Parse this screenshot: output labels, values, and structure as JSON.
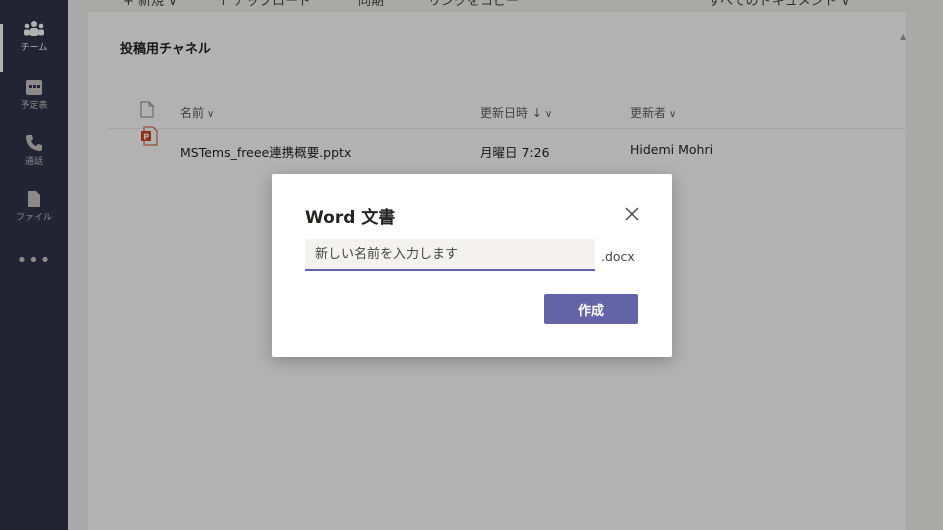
{
  "rail": {
    "items": [
      {
        "label": "チーム",
        "icon": "teams-icon"
      },
      {
        "label": "予定表",
        "icon": "calendar-icon"
      },
      {
        "label": "通話",
        "icon": "phone-icon"
      },
      {
        "label": "ファイル",
        "icon": "file-icon"
      }
    ],
    "more": "•••"
  },
  "toolbar": {
    "new_label": "+ 新規 ∨",
    "upload_label": "↑ アップロード",
    "sync_label": "同期",
    "copy_link_label": "リンクをコピー",
    "view_label": "すべてのドキュメント ∨"
  },
  "channel": {
    "title": "投稿用チャネル"
  },
  "table": {
    "headers": {
      "name": "名前",
      "modified": "更新日時 ↓",
      "modified_by": "更新者"
    },
    "rows": [
      {
        "name": "MSTems_freee連携概要.pptx",
        "modified": "月曜日 7:26",
        "modified_by": "Hidemi Mohri"
      }
    ]
  },
  "dialog": {
    "title": "Word 文書",
    "input_placeholder": "新しい名前を入力します",
    "extension": ".docx",
    "create_label": "作成"
  },
  "colors": {
    "accent": "#6264a7",
    "rail": "#33344a",
    "ppt": "#d24726"
  }
}
